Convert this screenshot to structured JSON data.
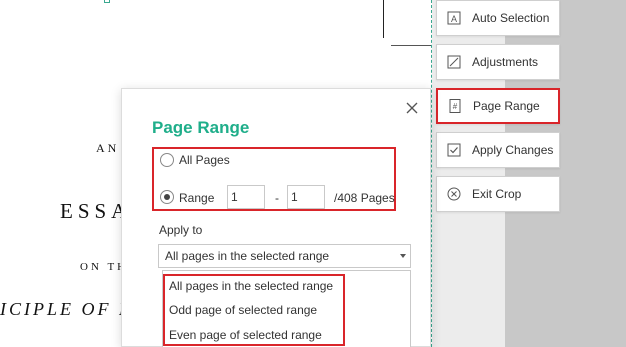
{
  "document": {
    "line1": "AN",
    "line2": "ESSA",
    "line3": "ON TH",
    "line4": "ICIPLE OF P"
  },
  "tools": [
    {
      "label": "Auto Selection",
      "icon": "auto-selection-icon"
    },
    {
      "label": "Adjustments",
      "icon": "adjustments-icon"
    },
    {
      "label": "Page Range",
      "icon": "page-range-icon"
    },
    {
      "label": "Apply Changes",
      "icon": "apply-changes-icon"
    },
    {
      "label": "Exit Crop",
      "icon": "exit-crop-icon"
    }
  ],
  "dialog": {
    "title": "Page Range",
    "all_pages_label": "All Pages",
    "range_label": "Range",
    "range_from": "1",
    "range_separator": "-",
    "range_to": "1",
    "total_pages": "/408 Pages",
    "selected_mode": "Range",
    "apply_to_label": "Apply to",
    "apply_to_selected": "All pages in the selected range",
    "apply_to_options": [
      "All pages in the selected range",
      "Odd page of selected range",
      "Even page of selected range"
    ]
  },
  "colors": {
    "accent_green": "#1fae8a",
    "highlight_red": "#d9252a"
  }
}
